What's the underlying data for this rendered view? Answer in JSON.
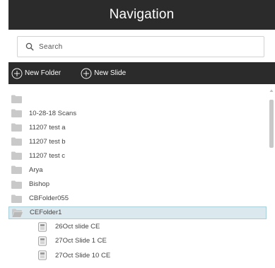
{
  "header": {
    "title": "Navigation"
  },
  "search": {
    "placeholder": "Search"
  },
  "toolbar": {
    "new_folder_label": "New Folder",
    "new_slide_label": "New Slide"
  },
  "tree": {
    "items": [
      {
        "label": ""
      },
      {
        "label": "10-28-18 Scans"
      },
      {
        "label": "11207 test a"
      },
      {
        "label": "11207 test b"
      },
      {
        "label": "11207 test c"
      },
      {
        "label": "Arya"
      },
      {
        "label": "Bishop"
      },
      {
        "label": "CBFolder055"
      },
      {
        "label": "CEFolder1"
      }
    ],
    "slides": [
      {
        "label": "26Oct slide CE"
      },
      {
        "label": "27Oct Slide 1 CE"
      },
      {
        "label": "27Oct Slide 10 CE"
      }
    ]
  },
  "colors": {
    "header_bg": "#2b2b2b",
    "selected_bg": "#dbe9ef",
    "folder": "#c9c9c9"
  }
}
